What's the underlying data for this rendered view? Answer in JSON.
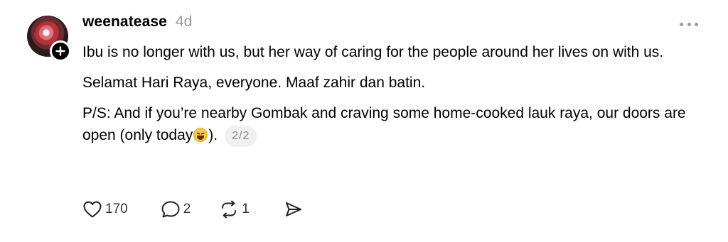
{
  "post": {
    "username": "weenatease",
    "timestamp": "4d",
    "paragraphs": {
      "p1": "Ibu is no longer with us, but her way of caring for the people around her lives on with us.",
      "p2": "Selamat Hari Raya, everyone. Maaf zahir dan batin.",
      "p3_before_emoji": "P/S: And if you’re nearby Gombak and craving some home-cooked lauk raya, our doors are open (only today",
      "p3_after_emoji": ")."
    },
    "page_indicator": "2/2",
    "emoji": "grinning-squinting-face-emoji"
  },
  "actions": {
    "likes": "170",
    "replies": "2",
    "reposts": "1"
  },
  "icons": {
    "avatar": "profile-avatar",
    "follow": "plus-icon",
    "more": "more-options-icon",
    "like": "heart-icon",
    "reply": "comment-icon",
    "repost": "repost-icon",
    "share": "send-icon"
  },
  "colors": {
    "text": "#000000",
    "muted": "#999999",
    "badge_bg": "#f0f0f0"
  }
}
